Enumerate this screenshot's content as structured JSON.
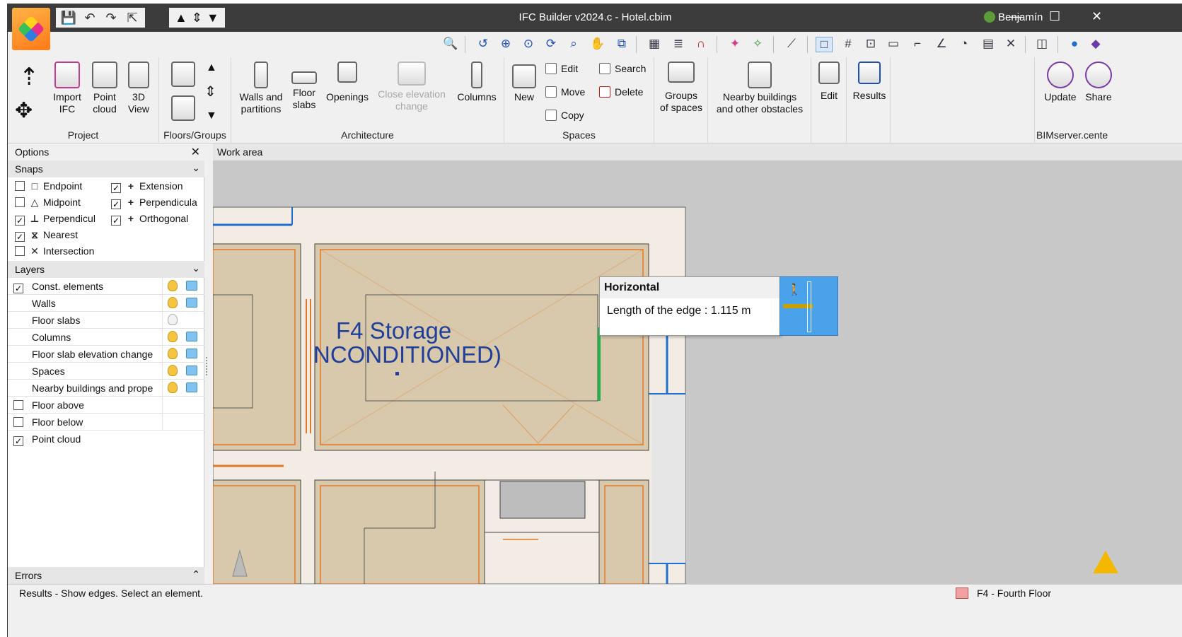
{
  "window": {
    "title": "IFC Builder v2024.c - Hotel.cbim",
    "user": "Benjamín",
    "minimize": "—",
    "maximize": "☐",
    "close": "✕"
  },
  "quick_access": [
    "💾",
    "↶",
    "↷",
    "⇱"
  ],
  "quick_access_nav": [
    "▲",
    "⇕",
    "▼"
  ],
  "toolbar_icons": [
    "search-icon",
    "zoom-previous-icon",
    "zoom-all-icon",
    "zoom-window-icon",
    "regen-icon",
    "zoom-icon",
    "pan-icon",
    "view-icon",
    "dxf-icon",
    "layers-icon",
    "magnet-icon",
    "color-icon",
    "paint-icon",
    "measure-icon",
    "box-icon",
    "grid-icon",
    "snap-icon",
    "scale-icon",
    "crop-icon",
    "angle-icon",
    "orbit-icon",
    "calc-icon",
    "close-x-icon",
    "panel-icon",
    "globe-icon"
  ],
  "ribbon": {
    "project": {
      "label": "Project",
      "import": "Import\nIFC",
      "point_cloud": "Point\ncloud",
      "view3d": "3D\nView"
    },
    "floors": {
      "label": "Floors/Groups"
    },
    "architecture": {
      "label": "Architecture",
      "walls": "Walls and\npartitions",
      "floor_slabs": "Floor\nslabs",
      "openings": "Openings",
      "close_elevation": "Close elevation\nchange",
      "columns": "Columns"
    },
    "spaces": {
      "label": "Spaces",
      "new": "New",
      "edit": "Edit",
      "move": "Move",
      "copy": "Copy",
      "search": "Search",
      "delete": "Delete"
    },
    "groups": {
      "groups_of_spaces": "Groups\nof spaces"
    },
    "nearby": {
      "nearby": "Nearby buildings\nand other obstacles"
    },
    "edit": {
      "edit": "Edit"
    },
    "results": {
      "results": "Results"
    },
    "bimserver": {
      "label": "BIMserver.cente",
      "update": "Update",
      "share": "Share"
    }
  },
  "options": {
    "title": "Options",
    "close": "✕",
    "snaps_title": "Snaps",
    "snaps": [
      {
        "label": "Endpoint",
        "checked": false,
        "icon": "□"
      },
      {
        "label": "Midpoint",
        "checked": false,
        "icon": "△"
      },
      {
        "label": "Perpendicul",
        "checked": true,
        "icon": "⊥"
      },
      {
        "label": "Nearest",
        "checked": true,
        "icon": "⧖"
      },
      {
        "label": "Intersection",
        "checked": false,
        "icon": "✕"
      }
    ],
    "snaps_right": [
      {
        "label": "Extension",
        "checked": true,
        "icon": "+"
      },
      {
        "label": "Perpendicula",
        "checked": true,
        "icon": "+"
      },
      {
        "label": "Orthogonal",
        "checked": true,
        "icon": "+"
      }
    ],
    "layers_title": "Layers",
    "layers": [
      {
        "label": "Const. elements",
        "checked": true,
        "cb": true,
        "bulb": "on",
        "box": true
      },
      {
        "label": "Walls",
        "cb": false,
        "bulb": "on",
        "box": true
      },
      {
        "label": "Floor slabs",
        "cb": false,
        "bulb": "off",
        "box": false
      },
      {
        "label": "Columns",
        "cb": false,
        "bulb": "on",
        "box": true
      },
      {
        "label": "Floor slab elevation change",
        "cb": false,
        "bulb": "on",
        "box": true
      },
      {
        "label": "Spaces",
        "cb": false,
        "bulb": "on",
        "box": true
      },
      {
        "label": "Nearby buildings and prope",
        "cb": false,
        "bulb": "on",
        "box": true
      },
      {
        "label": "Floor above",
        "checked": false,
        "cb": true,
        "bulb": "none",
        "box": false
      },
      {
        "label": "Floor below",
        "checked": false,
        "cb": true,
        "bulb": "none",
        "box": false
      },
      {
        "label": "Point cloud",
        "checked": true,
        "cb": true,
        "bulb": "none",
        "box": false
      }
    ],
    "errors_title": "Errors"
  },
  "work_area": {
    "title": "Work area",
    "room_label_1": "F4 Storage",
    "room_label_2": "NCONDITIONED)"
  },
  "tooltip": {
    "title": "Horizontal",
    "text": "Length of the edge : 1.115 m"
  },
  "status": {
    "text": "Results - Show edges. Select an element.",
    "floor": "F4 - Fourth Floor"
  },
  "colors": {
    "accent_blue": "#1f6fd1",
    "wall_orange": "#e07a2a",
    "room_fill": "#d9c9ac",
    "selected_green": "#21b04a"
  }
}
